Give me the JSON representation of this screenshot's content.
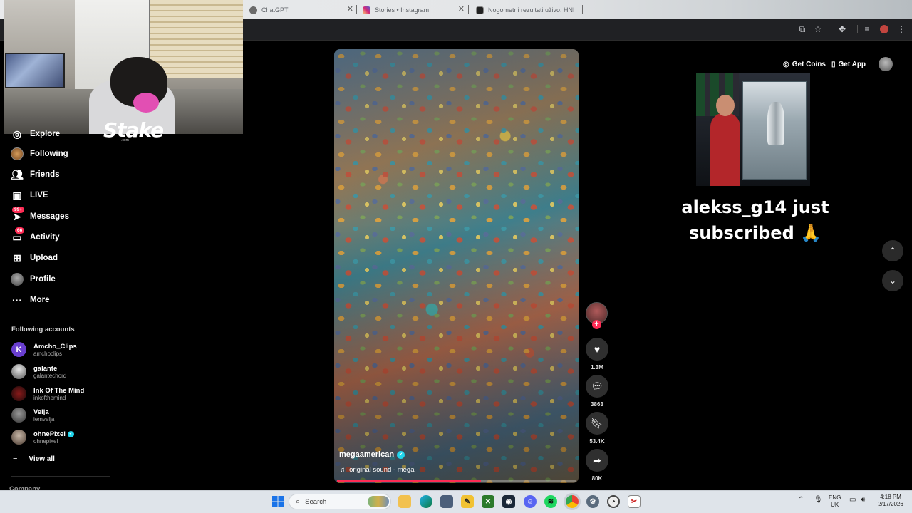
{
  "browser": {
    "tabs": [
      {
        "title": "ChatGPT",
        "icon": "chatgpt-icon",
        "color": "#6b6b6b"
      },
      {
        "title": "Stories • Instagram",
        "icon": "instagram-icon",
        "color": "#d62976"
      },
      {
        "title": "Nogometni rezultati uživo: HNL",
        "icon": "livescore-icon",
        "color": "#222222"
      }
    ]
  },
  "overlay": {
    "brand": "Stake",
    "brand_sub": ".com"
  },
  "sidebar": {
    "items": [
      {
        "label": "Explore",
        "icon": "compass-icon"
      },
      {
        "label": "Following",
        "icon": "following-avatar-icon"
      },
      {
        "label": "Friends",
        "icon": "friends-icon"
      },
      {
        "label": "LIVE",
        "icon": "live-tv-icon"
      },
      {
        "label": "Messages",
        "icon": "messages-icon",
        "badge": "99+"
      },
      {
        "label": "Activity",
        "icon": "activity-icon",
        "badge": "66"
      },
      {
        "label": "Upload",
        "icon": "upload-icon"
      },
      {
        "label": "Profile",
        "icon": "profile-icon"
      },
      {
        "label": "More",
        "icon": "more-icon"
      }
    ],
    "following_title": "Following accounts",
    "accounts": [
      {
        "name": "Amcho_Clips",
        "handle": "amchoclips"
      },
      {
        "name": "galante",
        "handle": "galantechord"
      },
      {
        "name": "Ink Of The Mind",
        "handle": "inkofthemind"
      },
      {
        "name": "Velja",
        "handle": "iemvelja"
      },
      {
        "name": "ohnePixel",
        "handle": "ohnepixel",
        "verified": true
      }
    ],
    "view_all": "View all",
    "company": "Company"
  },
  "video": {
    "author": "megaamerican",
    "sound": "original sound - mega",
    "progress": 0.6,
    "likes": "1.3M",
    "comments": "3863",
    "saves": "53.4K",
    "shares": "80K"
  },
  "header": {
    "get_coins": "Get Coins",
    "get_app": "Get App"
  },
  "alert": {
    "text": "alekss_g14 just subscribed 🙏"
  },
  "taskbar": {
    "search": "Search",
    "lang_top": "ENG",
    "lang_bottom": "UK",
    "time": "4:18 PM",
    "date": "2/17/2026"
  },
  "colors": {
    "accent": "#fe2c55",
    "verified": "#20d5ec"
  }
}
